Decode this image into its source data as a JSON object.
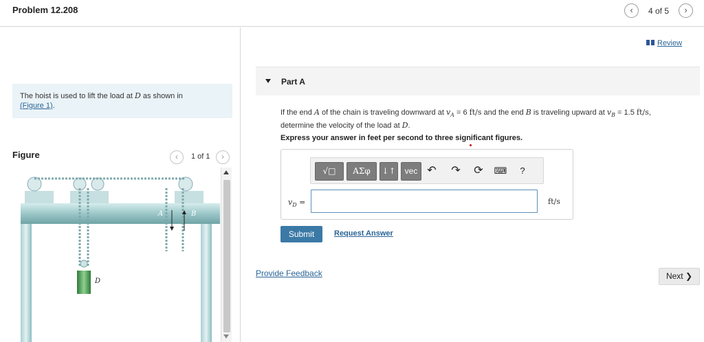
{
  "header": {
    "problem_title": "Problem 12.208",
    "page_count": "4 of 5",
    "prev_icon": "chevron-left-icon",
    "next_icon": "chevron-right-icon"
  },
  "left_panel": {
    "intro_text": "The hoist is used to lift the load at D as shown in",
    "intro_prefix": "The hoist is used to lift the load at ",
    "intro_var": "D",
    "intro_suffix": " as shown in",
    "figure_link": "(Figure 1)",
    "figure_link_tail": ".",
    "figure_label": "Figure",
    "figure_count": "1 of 1",
    "figure_labels": {
      "A": "A",
      "B": "B",
      "D": "D"
    }
  },
  "review": {
    "label": "Review",
    "icon": "review-icon"
  },
  "part": {
    "title": "Part A",
    "q_intro": "If the end ",
    "q_A": "A",
    "q_mid1": " of the chain is traveling downward at ",
    "q_vA": "v",
    "q_vA_sub": "A",
    "q_vA_val": " = 6 ",
    "q_unit1": "ft/s",
    "q_mid2": " and the end ",
    "q_B": "B",
    "q_mid3": " is traveling upward at ",
    "q_vB": "v",
    "q_vB_sub": "B",
    "q_vB_val": " = 1.5 ",
    "q_unit2": "ft/s",
    "q_mid4": ",",
    "q_line2_pre": "determine the velocity of the load at ",
    "q_D": "D",
    "q_end": ".",
    "express": "Express your answer in feet per second to three significant figures."
  },
  "answer": {
    "toolbar": {
      "templates_label": "√□",
      "greek_label": "ΑΣφ",
      "sort_label": "↓↑",
      "vec_label": "vec",
      "undo_icon": "undo-icon",
      "redo_icon": "redo-icon",
      "reset_icon": "reset-icon",
      "keyboard_icon": "keyboard-icon",
      "help_label": "?"
    },
    "var_label": "v",
    "var_sub": "D",
    "var_eq": " =",
    "input_value": "",
    "unit": "ft/s"
  },
  "actions": {
    "submit_label": "Submit",
    "request_answer_label": "Request Answer",
    "feedback_label": "Provide Feedback",
    "next_label": "Next"
  }
}
